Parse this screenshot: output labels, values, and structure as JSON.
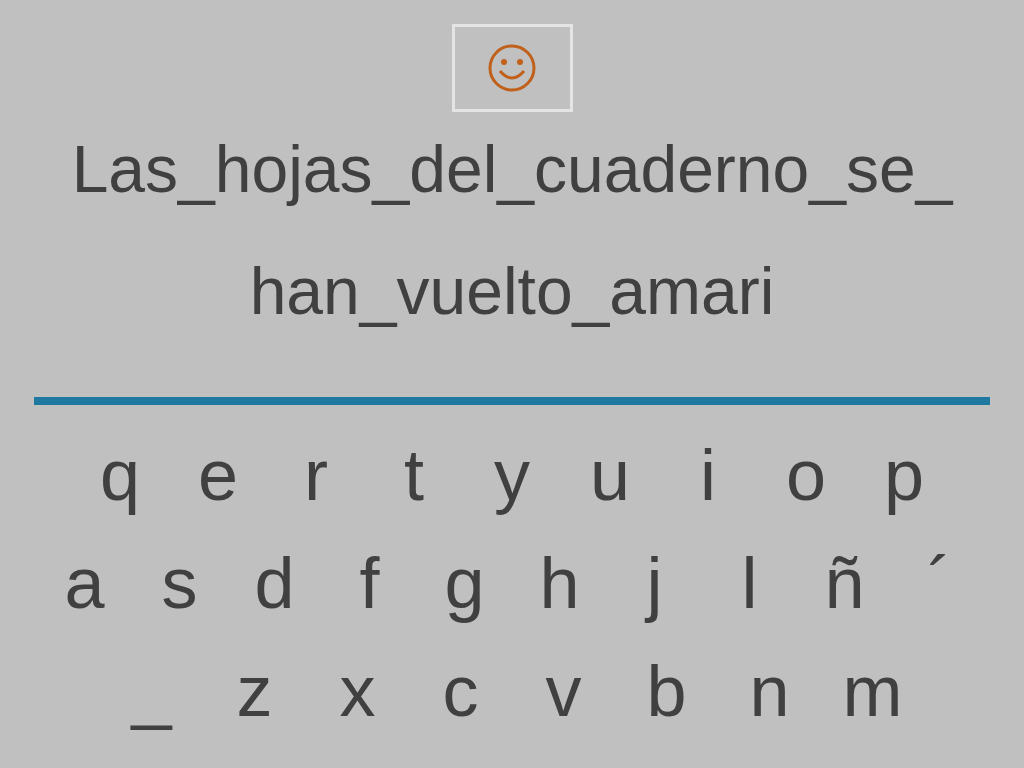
{
  "phrase_lines": [
    "Las_hojas_del_cuaderno_se_",
    "han_vuelto_amari"
  ],
  "keyboard_rows": [
    [
      "q",
      "e",
      "r",
      "t",
      "y",
      "u",
      "i",
      "o",
      "p"
    ],
    [
      "a",
      "s",
      "d",
      "f",
      "g",
      "h",
      "j",
      "l",
      "ñ",
      "´"
    ],
    [
      "_",
      "z",
      "x",
      "c",
      "v",
      "b",
      "n",
      "m"
    ]
  ]
}
